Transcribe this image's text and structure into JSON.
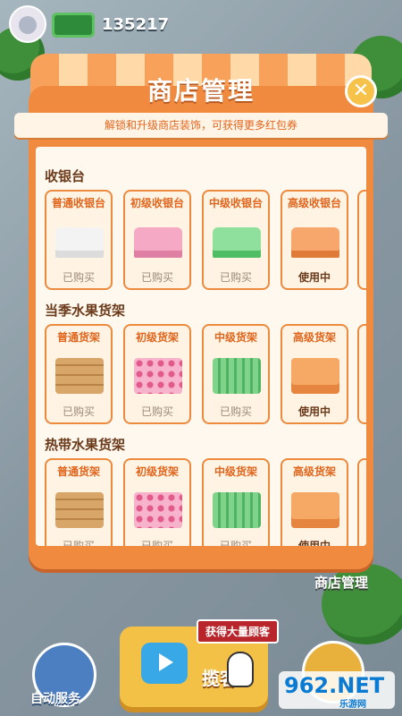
{
  "hud": {
    "money": "135217"
  },
  "dialog": {
    "title": "商店管理",
    "close_label": "✕",
    "subtitle": "解锁和升级商店装饰，可获得更多红包券",
    "sections": [
      {
        "title": "收银台",
        "items": [
          {
            "name": "普通收银台",
            "status": "已购买"
          },
          {
            "name": "初级收银台",
            "status": "已购买"
          },
          {
            "name": "中级收银台",
            "status": "已购买"
          },
          {
            "name": "高级收银台",
            "status": "使用中"
          }
        ]
      },
      {
        "title": "当季水果货架",
        "items": [
          {
            "name": "普通货架",
            "status": "已购买"
          },
          {
            "name": "初级货架",
            "status": "已购买"
          },
          {
            "name": "中级货架",
            "status": "已购买"
          },
          {
            "name": "高级货架",
            "status": "使用中"
          }
        ]
      },
      {
        "title": "热带水果货架",
        "items": [
          {
            "name": "普通货架",
            "status": "已购买"
          },
          {
            "name": "初级货架",
            "status": "已购买"
          },
          {
            "name": "中级货架",
            "status": "已购买"
          },
          {
            "name": "高级货架",
            "status": "使用中"
          }
        ]
      }
    ]
  },
  "shop_label": "商店管理",
  "bottom": {
    "auto_service": "自动服务",
    "customers_tag": "获得大量顾客",
    "main_button_label": "揽客"
  },
  "watermark": {
    "text": "962.NET",
    "sub": "乐游网"
  },
  "colors": {
    "accent": "#ef8a3f",
    "panel_inner": "#fff8ef",
    "title_text": "#ffffff"
  }
}
